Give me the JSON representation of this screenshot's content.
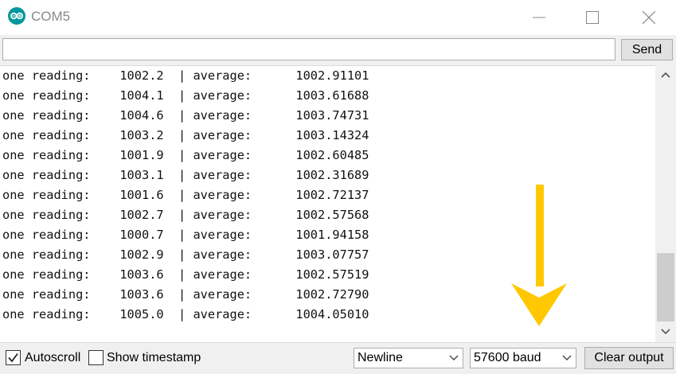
{
  "window": {
    "title": "COM5",
    "logo_icon": "arduino-logo-icon",
    "controls": [
      "minimize-icon",
      "maximize-icon",
      "close-icon"
    ]
  },
  "toolbar": {
    "input_value": "",
    "send_label": "Send"
  },
  "output": {
    "lines": [
      "one reading:    1002.2  | average:      1002.91101",
      "one reading:    1004.1  | average:      1003.61688",
      "one reading:    1004.6  | average:      1003.74731",
      "one reading:    1003.2  | average:      1003.14324",
      "one reading:    1001.9  | average:      1002.60485",
      "one reading:    1003.1  | average:      1002.31689",
      "one reading:    1001.6  | average:      1002.72137",
      "one reading:    1002.7  | average:      1002.57568",
      "one reading:    1000.7  | average:      1001.94158",
      "one reading:    1002.9  | average:      1003.07757",
      "one reading:    1003.6  | average:      1002.57519",
      "one reading:    1003.6  | average:      1002.72790",
      "one reading:    1005.0  | average:      1004.05010"
    ]
  },
  "annotation": {
    "arrow_color": "#ffc800",
    "arrow_icon": "down-arrow-icon"
  },
  "statusbar": {
    "autoscroll_label": "Autoscroll",
    "autoscroll_checked": true,
    "timestamp_label": "Show timestamp",
    "timestamp_checked": false,
    "line_ending": "Newline",
    "baud_rate": "57600 baud",
    "clear_label": "Clear output"
  },
  "colors": {
    "logo": "#00979c",
    "title_text": "#8a8a8a",
    "chrome": "#f0f0f0"
  }
}
